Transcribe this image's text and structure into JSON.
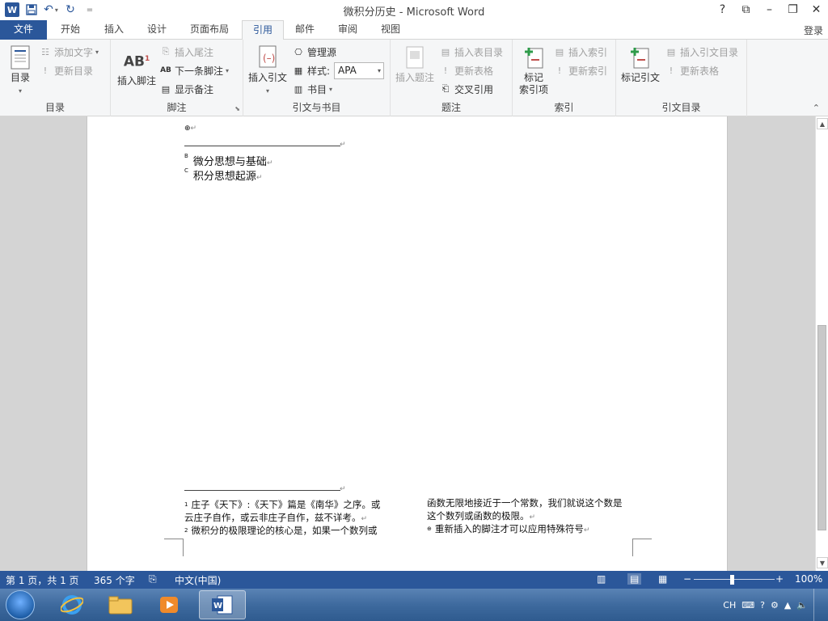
{
  "window": {
    "title": "微积分历史 - Microsoft Word",
    "login": "登录",
    "controls": [
      "?",
      "⧉",
      "–",
      "❐",
      "✕"
    ]
  },
  "tabs": [
    "文件",
    "开始",
    "插入",
    "设计",
    "页面布局",
    "引用",
    "邮件",
    "审阅",
    "视图"
  ],
  "active_tab": "引用",
  "ribbon": {
    "toc": {
      "label": "目录",
      "big": "目录",
      "add_text": "添加文字",
      "update_toc": "更新目录"
    },
    "footnote": {
      "label": "脚注",
      "insert_footnote": "插入脚注",
      "insert_endnote": "插入尾注",
      "next_footnote": "下一条脚注",
      "show_notes": "显示备注"
    },
    "citations": {
      "label": "引文与书目",
      "insert_citation": "插入引文",
      "manage_sources": "管理源",
      "style_label": "样式:",
      "style_value": "APA",
      "bibliography": "书目"
    },
    "captions": {
      "label": "题注",
      "insert_caption": "插入题注",
      "insert_tof": "插入表目录",
      "update_table": "更新表格",
      "cross_ref": "交叉引用"
    },
    "index": {
      "label": "索引",
      "mark_entry": "标记\n索引项",
      "insert_index": "插入索引",
      "update_index": "更新索引"
    },
    "toa": {
      "label": "引文目录",
      "mark_citation": "标记引文",
      "insert_toa": "插入引文目录",
      "update_table": "更新表格"
    }
  },
  "document": {
    "symbol": "⊕",
    "endnotes": [
      {
        "mark": "B",
        "text": "微分思想与基础"
      },
      {
        "mark": "C",
        "text": "积分思想起源"
      }
    ],
    "footnotes_left": [
      {
        "mark": "1",
        "line1": "庄子《天下》:《天下》篇是《南华》之序。或",
        "line2": "云庄子自作，或云非庄子自作，兹不详考。"
      },
      {
        "mark": "2",
        "line1": "微积分的极限理论的核心是，如果一个数列或",
        "line2": ""
      }
    ],
    "footnotes_right": [
      {
        "mark": "",
        "line1": "函数无限地接近于一个常数，我们就说这个数是",
        "line2": "这个数列或函数的极限。"
      },
      {
        "mark": "⊕",
        "line1": "重新插入的脚注才可以应用特殊符号",
        "line2": ""
      }
    ]
  },
  "status": {
    "page": "第 1 页，共 1 页",
    "words": "365 个字",
    "language": "中文(中国)",
    "zoom": "100%",
    "zoom_minus": "−",
    "zoom_plus": "+"
  },
  "tray": {
    "lang": "CH"
  }
}
